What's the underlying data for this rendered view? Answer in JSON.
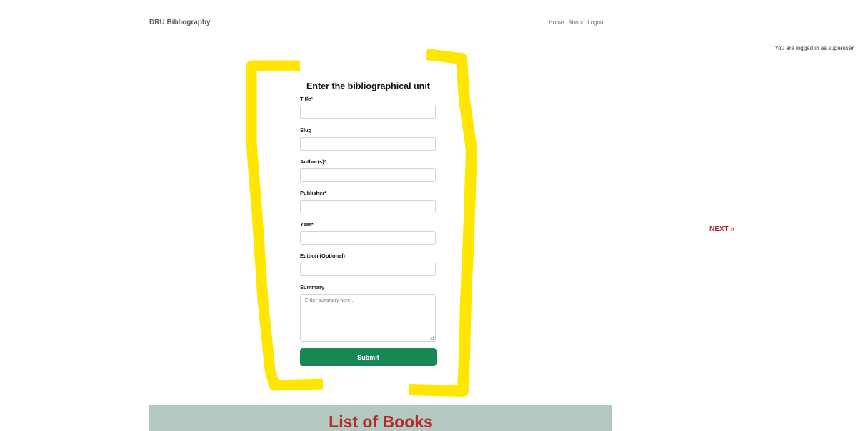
{
  "navbar": {
    "brand": "DRU Bibliography",
    "links": [
      "Home",
      "About",
      "Logout"
    ]
  },
  "user_status": "You are logged in as superuser",
  "form": {
    "title": "Enter the bibliographical unit",
    "fields": [
      {
        "label": "Title*",
        "value": ""
      },
      {
        "label": "Slug",
        "value": ""
      },
      {
        "label": "Author(s)*",
        "value": ""
      },
      {
        "label": "Publisher*",
        "value": ""
      },
      {
        "label": "Year*",
        "value": ""
      },
      {
        "label": "Edition (Optional)",
        "value": ""
      }
    ],
    "summary": {
      "label": "Summary",
      "placeholder": "Enter summary here...",
      "value": ""
    },
    "submit_label": "Submit"
  },
  "pagination": {
    "next_label": "NEXT »"
  },
  "list_section": {
    "title": "List of Books"
  },
  "colors": {
    "highlight_marker": "#ffe600",
    "submit_button": "#198754",
    "next_link": "#b02a37",
    "banner_bg": "#b3c8bf",
    "banner_title": "#b52a2a"
  }
}
